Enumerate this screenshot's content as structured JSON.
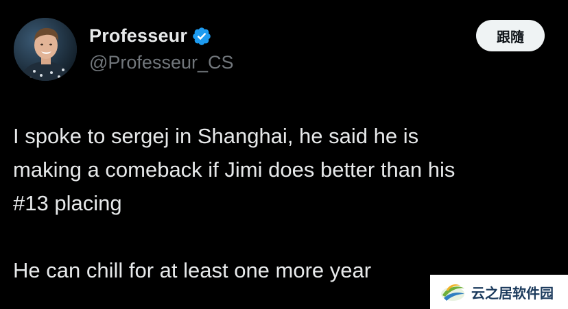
{
  "author": {
    "display_name": "Professeur",
    "handle": "@Professeur_CS",
    "verified": true
  },
  "follow_button_label": "跟隨",
  "tweet": {
    "paragraph1": [
      "I spoke to sergej in Shanghai, he said he is",
      "making a comeback if Jimi does better than his",
      "#13 placing"
    ],
    "paragraph2": [
      "He can chill for at least one more year"
    ]
  },
  "watermark": {
    "text": "云之居软件园",
    "logo_icon": "cloud-swoosh-logo-icon"
  },
  "colors": {
    "background": "#000000",
    "text_primary": "#e7e9ea",
    "text_secondary": "#71767b",
    "verified_blue": "#1d9bf0",
    "follow_bg": "#eff3f4"
  }
}
